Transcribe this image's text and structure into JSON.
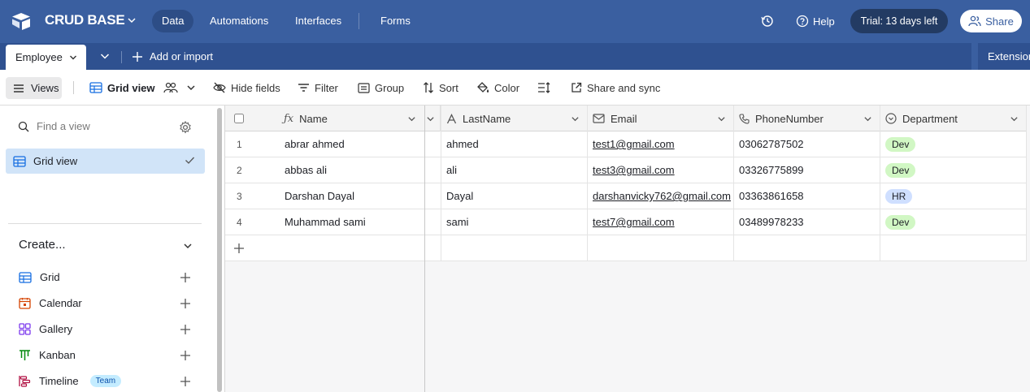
{
  "topbar": {
    "base_name": "CRUD BASE",
    "nav": [
      "Data",
      "Automations",
      "Interfaces",
      "Forms"
    ],
    "help": "Help",
    "trial": "Trial: 13 days left",
    "share": "Share"
  },
  "tabbar": {
    "active_table": "Employee",
    "add_import": "Add or import",
    "extensions": "Extension"
  },
  "toolbar": {
    "views": "Views",
    "view_name": "Grid view",
    "hide_fields": "Hide fields",
    "filter": "Filter",
    "group": "Group",
    "sort": "Sort",
    "color": "Color",
    "share_sync": "Share and sync"
  },
  "sidebar": {
    "find_placeholder": "Find a view",
    "views": [
      "Grid view"
    ],
    "create_label": "Create...",
    "create_items": [
      {
        "label": "Grid",
        "icon": "grid-icon",
        "color": "#166ee1"
      },
      {
        "label": "Calendar",
        "icon": "calendar-icon",
        "color": "#d54401"
      },
      {
        "label": "Gallery",
        "icon": "gallery-icon",
        "color": "#7c39ed"
      },
      {
        "label": "Kanban",
        "icon": "kanban-icon",
        "color": "#048a0e"
      },
      {
        "label": "Timeline",
        "icon": "timeline-icon",
        "color": "#b10f41",
        "badge": "Team"
      }
    ]
  },
  "table": {
    "columns": [
      "Name",
      "LastName",
      "Email",
      "PhoneNumber",
      "Department"
    ],
    "rows": [
      {
        "num": "1",
        "name": "abrar ahmed",
        "last": "ahmed",
        "email": "test1@gmail.com",
        "phone": "03062787502",
        "dept": "Dev"
      },
      {
        "num": "2",
        "name": "abbas ali",
        "last": "ali",
        "email": "test3@gmail.com",
        "phone": "03326775899",
        "dept": "Dev"
      },
      {
        "num": "3",
        "name": "Darshan Dayal",
        "last": "Dayal",
        "email": "darshanvicky762@gmail.com",
        "phone": "03363861658",
        "dept": "HR"
      },
      {
        "num": "4",
        "name": "Muhammad sami",
        "last": "sami",
        "email": "test7@gmail.com",
        "phone": "03489978233",
        "dept": "Dev"
      }
    ]
  },
  "colors": {
    "topbar": "#3a5fa0",
    "dept_dev_bg": "#d1f7c4",
    "dept_hr_bg": "#cfdfff"
  }
}
